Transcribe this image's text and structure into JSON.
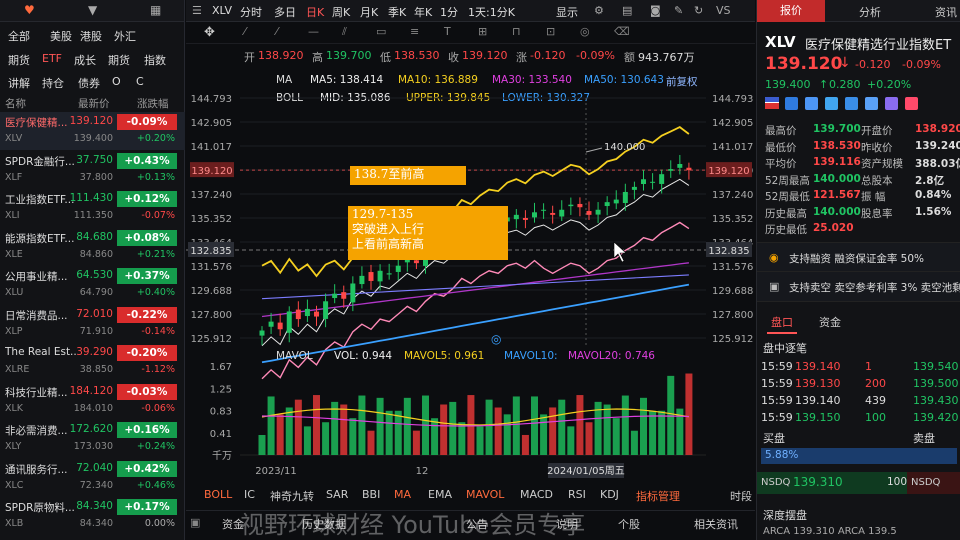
{
  "left": {
    "categories_row1": [
      "全部",
      "美股",
      "港股",
      "外汇"
    ],
    "categories_row2": [
      "期货",
      "ETF",
      "成长",
      "期货",
      "指数"
    ],
    "categories_row3": [
      "讲解",
      "持仓",
      "债券",
      "O",
      "C"
    ],
    "active_category": "ETF",
    "headers": {
      "name": "名称",
      "price": "最新价",
      "change": "涨跌幅"
    },
    "watchlist": [
      {
        "name": "医疗保健精...",
        "code": "XLV",
        "price": "139.120",
        "prev": "139.400",
        "change": "-0.09%",
        "sub": "+0.20%",
        "dir": "dn",
        "subdir": "up",
        "selected": true
      },
      {
        "name": "SPDR金融行...",
        "code": "XLF",
        "price": "37.750",
        "prev": "37.800",
        "change": "+0.43%",
        "sub": "+0.13%",
        "dir": "up",
        "subdir": "up"
      },
      {
        "name": "工业指数ETF...",
        "code": "XLI",
        "price": "111.430",
        "prev": "111.350",
        "change": "+0.12%",
        "sub": "-0.07%",
        "dir": "up",
        "subdir": "dn"
      },
      {
        "name": "能源指数ETF...",
        "code": "XLE",
        "price": "84.680",
        "prev": "84.860",
        "change": "+0.08%",
        "sub": "+0.21%",
        "dir": "up",
        "subdir": "up"
      },
      {
        "name": "公用事业精...",
        "code": "XLU",
        "price": "64.530",
        "prev": "64.790",
        "change": "+0.37%",
        "sub": "+0.40%",
        "dir": "up",
        "subdir": "up"
      },
      {
        "name": "日常消费品...",
        "code": "XLP",
        "price": "72.010",
        "prev": "71.910",
        "change": "-0.22%",
        "sub": "-0.14%",
        "dir": "dn",
        "subdir": "dn"
      },
      {
        "name": "The Real Est...",
        "code": "XLRE",
        "price": "39.290",
        "prev": "38.850",
        "change": "-0.20%",
        "sub": "-1.12%",
        "dir": "dn",
        "subdir": "dn"
      },
      {
        "name": "科技行业精...",
        "code": "XLK",
        "price": "184.120",
        "prev": "184.010",
        "change": "-0.03%",
        "sub": "-0.06%",
        "dir": "dn",
        "subdir": "dn"
      },
      {
        "name": "非必需消费...",
        "code": "XLY",
        "price": "172.620",
        "prev": "173.030",
        "change": "+0.16%",
        "sub": "+0.24%",
        "dir": "up",
        "subdir": "up"
      },
      {
        "name": "通讯服务行...",
        "code": "XLC",
        "price": "72.040",
        "prev": "72.340",
        "change": "+0.42%",
        "sub": "+0.46%",
        "dir": "up",
        "subdir": "up"
      },
      {
        "name": "SPDR原物料...",
        "code": "XLB",
        "price": "84.340",
        "prev": "84.340",
        "change": "+0.17%",
        "sub": "0.00%",
        "dir": "up",
        "subdir": "neutral"
      }
    ]
  },
  "toolbar": {
    "symbol": "XLV",
    "timeframes": [
      "分时",
      "多日",
      "日K",
      "周K",
      "月K",
      "季K",
      "年K",
      "1分",
      "1天:1分K"
    ],
    "active": "日K",
    "display": "显示",
    "right_label": "VS"
  },
  "ohlc": {
    "open_label": "开",
    "open": "138.920",
    "high_label": "高",
    "high": "139.700",
    "low_label": "低",
    "low": "138.530",
    "close_label": "收",
    "close": "139.120",
    "chg_label": "涨",
    "chg": "-0.120",
    "pct": "-0.09%",
    "amount_label": "额",
    "amount": "943.767万"
  },
  "ma_legend": {
    "name": "MA",
    "ma5": "MA5: 138.414",
    "ma10": "MA10: 136.889",
    "ma30": "MA30: 133.540",
    "ma50": "MA50: 130.643",
    "adj": "前复权"
  },
  "boll_legend": {
    "name": "BOLL",
    "mid": "MID: 135.086",
    "upper": "UPPER: 139.845",
    "lower": "LOWER: 130.327"
  },
  "vol_legend": {
    "name": "MAVOL",
    "vol": "VOL: 0.944",
    "mavol5": "MAVOL5: 0.961",
    "mavol10": "MAVOL10:",
    "mavol20": "MAVOL20: 0.746"
  },
  "annotations": [
    {
      "text": "138.7至前高"
    },
    {
      "lines": [
        "129.7-135",
        "突破进入上行",
        "上看前高新高"
      ]
    }
  ],
  "peak_label": "140.000",
  "price_ticks": [
    "144.793",
    "142.905",
    "141.017",
    "139.129",
    "137.240",
    "135.352",
    "133.464",
    "131.576",
    "129.688",
    "127.800",
    "125.912"
  ],
  "price_axis_left_hl": "139.120",
  "price_axis_right_hl": "139.120",
  "cross_price": "132.835",
  "vol_ticks": [
    "1.67",
    "1.25",
    "0.83",
    "0.41",
    "千万"
  ],
  "date_ticks": [
    "2023/11",
    "12",
    "2024/01/05周五"
  ],
  "indicators": [
    "BOLL",
    "IC",
    "神奇九转",
    "SAR",
    "BBI",
    "MA",
    "EMA",
    "MAVOL",
    "MACD",
    "RSI",
    "KDJ",
    "指标管理",
    "时段"
  ],
  "bottom_tabs": [
    "资金",
    "历史数据",
    "公告",
    "说明",
    "个股",
    "相关资讯"
  ],
  "watermark": "视野环球财经 YouTube会员专享",
  "right": {
    "tabs": [
      "报价",
      "分析",
      "资讯"
    ],
    "symbol": "XLV",
    "name": "医疗保健精选行业指数ET",
    "price": "139.120",
    "arrow": "↓",
    "chg": "-0.120",
    "pct": "-0.09%",
    "after": "139.400",
    "after_chg": "0.280",
    "after_pct": "+0.20%",
    "stats": [
      {
        "k": "最高价",
        "v": "139.700",
        "c": "up"
      },
      {
        "k": "开盘价",
        "v": "138.920",
        "c": "dn"
      },
      {
        "k": "最低价",
        "v": "138.530",
        "c": "dn"
      },
      {
        "k": "昨收价",
        "v": "139.240",
        "c": "n"
      },
      {
        "k": "平均价",
        "v": "139.116",
        "c": "dn"
      },
      {
        "k": "资产规模",
        "v": "388.03亿",
        "c": "n"
      },
      {
        "k": "52周最高",
        "v": "140.000",
        "c": "up"
      },
      {
        "k": "总股本",
        "v": "2.8亿",
        "c": "n"
      },
      {
        "k": "52周最低",
        "v": "121.567",
        "c": "dn"
      },
      {
        "k": "振 幅",
        "v": "0.84%",
        "c": "n"
      },
      {
        "k": "历史最高",
        "v": "140.000",
        "c": "up"
      },
      {
        "k": "股息率",
        "v": "1.56%",
        "c": "n"
      },
      {
        "k": "历史最低",
        "v": "25.020",
        "c": "dn"
      }
    ],
    "margin_text": "支持融资 融资保证金率 50%",
    "short_text": "支持卖空 卖空参考利率 3% 卖空池剩",
    "book_tabs": [
      "盘口",
      "资金"
    ],
    "ticks_title": "盘中逐笔",
    "ticks": [
      {
        "t": "15:59",
        "p": "139.140",
        "v": "1",
        "c": "dn",
        "r": "139.540"
      },
      {
        "t": "15:59",
        "p": "139.130",
        "v": "200",
        "c": "dn",
        "r": "139.500"
      },
      {
        "t": "15:59",
        "p": "139.140",
        "v": "439",
        "c": "n",
        "r": "139.430"
      },
      {
        "t": "15:59",
        "p": "139.150",
        "v": "100",
        "c": "up",
        "r": "139.420"
      }
    ],
    "buy": "买盘",
    "sell": "卖盘",
    "buy_pct": "5.88%",
    "nsdq_label": "NSDQ",
    "nsdq_price": "139.310",
    "nsdq_vol": "100",
    "nsdq_right": "NSDQ",
    "depth": "深度摆盘",
    "depth_row": "ARCA 139.310  ARCA 139.5"
  },
  "colors": {
    "up": "#20c463",
    "down": "#ff4848",
    "accent": "#ff5555",
    "annotation": "#f5a300"
  }
}
